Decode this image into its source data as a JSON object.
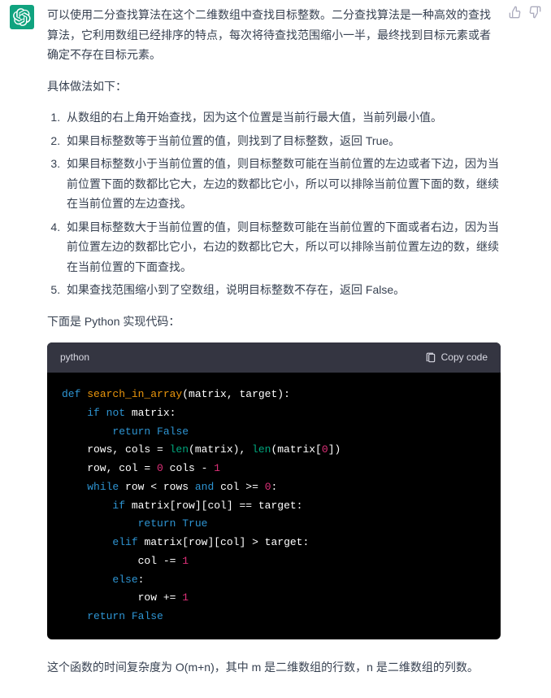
{
  "answer": {
    "intro": "可以使用二分查找算法在这个二维数组中查找目标整数。二分查找算法是一种高效的查找算法，它利用数组已经排序的特点，每次将待查找范围缩小一半，最终找到目标元素或者确定不存在目标元素。",
    "steps_title": "具体做法如下：",
    "steps": [
      "从数组的右上角开始查找，因为这个位置是当前行最大值，当前列最小值。",
      "如果目标整数等于当前位置的值，则找到了目标整数，返回 True。",
      "如果目标整数小于当前位置的值，则目标整数可能在当前位置的左边或者下边，因为当前位置下面的数都比它大，左边的数都比它小，所以可以排除当前位置下面的数，继续在当前位置的左边查找。",
      "如果目标整数大于当前位置的值，则目标整数可能在当前位置的下面或者右边，因为当前位置左边的数都比它小，右边的数都比它大，所以可以排除当前位置左边的数，继续在当前位置的下面查找。",
      "如果查找范围缩小到了空数组，说明目标整数不存在，返回 False。"
    ],
    "code_intro": "下面是 Python 实现代码：",
    "complexity": "这个函数的时间复杂度为 O(m+n)，其中 m 是二维数组的行数，n 是二维数组的列数。"
  },
  "code": {
    "language": "python",
    "copy_label": "Copy code",
    "lines": [
      [
        [
          "kw",
          "def"
        ],
        [
          "",
          ", "
        ],
        [
          "fn",
          "search_in_array"
        ],
        [
          "",
          "(matrix, target):"
        ]
      ],
      [
        [
          "",
          "    "
        ],
        [
          "kw",
          "if"
        ],
        [
          "",
          ", "
        ],
        [
          "kw",
          "not"
        ],
        [
          "",
          ", matrix:"
        ]
      ],
      [
        [
          "",
          "        "
        ],
        [
          "kw",
          "return"
        ],
        [
          "",
          ", "
        ],
        [
          "bool",
          "False"
        ]
      ],
      [
        [
          "",
          "    rows, cols = "
        ],
        [
          "bi",
          "len"
        ],
        [
          "",
          "(matrix), "
        ],
        [
          "bi",
          "len"
        ],
        [
          "",
          "(matrix["
        ],
        [
          "n",
          "0"
        ],
        [
          "",
          "])"
        ]
      ],
      [
        [
          "",
          "    row, col = "
        ],
        [
          "n",
          "0"
        ],
        [
          "",
          ", cols - "
        ],
        [
          "n",
          "1"
        ]
      ],
      [
        [
          "",
          "    "
        ],
        [
          "kw",
          "while"
        ],
        [
          "",
          ", row < rows "
        ],
        [
          "kw",
          "and"
        ],
        [
          "",
          ", col >= "
        ],
        [
          "n",
          "0"
        ],
        [
          "",
          ":"
        ]
      ],
      [
        [
          "",
          "        "
        ],
        [
          "kw",
          "if"
        ],
        [
          "",
          ", matrix[row][col] == target:"
        ]
      ],
      [
        [
          "",
          "            "
        ],
        [
          "kw",
          "return"
        ],
        [
          "",
          ", "
        ],
        [
          "bool",
          "True"
        ]
      ],
      [
        [
          "",
          "        "
        ],
        [
          "kw",
          "elif"
        ],
        [
          "",
          ", matrix[row][col] > target:"
        ]
      ],
      [
        [
          "",
          "            col -= "
        ],
        [
          "n",
          "1"
        ]
      ],
      [
        [
          "",
          "        "
        ],
        [
          "kw",
          "else"
        ],
        [
          "",
          ":"
        ]
      ],
      [
        [
          "",
          "            row += "
        ],
        [
          "n",
          "1"
        ]
      ],
      [
        [
          "",
          "    "
        ],
        [
          "kw",
          "return"
        ],
        [
          "",
          ", "
        ],
        [
          "bool",
          "False"
        ]
      ]
    ]
  }
}
